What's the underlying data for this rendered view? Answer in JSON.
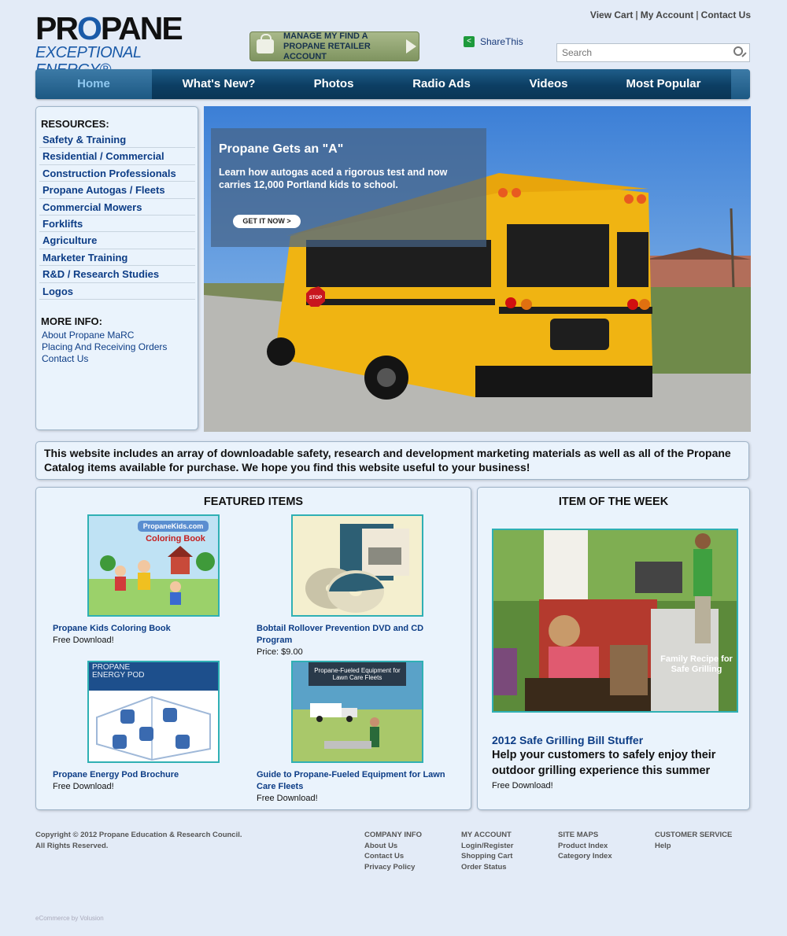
{
  "logo": {
    "word_pre": "PR",
    "word_o": "O",
    "word_post": "PANE",
    "tagline": "EXCEPTIONAL ENERGY®"
  },
  "top_links": {
    "cart": "View Cart",
    "account": "My Account",
    "contact": "Contact Us",
    "separator": "|"
  },
  "manage_button": {
    "label": "MANAGE MY FIND A PROPANE RETAILER ACCOUNT"
  },
  "share": {
    "label": "ShareThis"
  },
  "search": {
    "placeholder": "Search"
  },
  "nav": {
    "items": [
      {
        "label": "Home",
        "active": true
      },
      {
        "label": "What's New?"
      },
      {
        "label": "Photos"
      },
      {
        "label": "Radio Ads"
      },
      {
        "label": "Videos"
      },
      {
        "label": "Most Popular"
      }
    ]
  },
  "sidebar": {
    "resources_heading": "RESOURCES:",
    "resources": [
      "Safety & Training",
      "Residential / Commercial",
      "Construction Professionals",
      "Propane Autogas / Fleets",
      "Commercial Mowers",
      "Forklifts",
      "Agriculture",
      "Marketer Training",
      "R&D / Research Studies",
      "Logos"
    ],
    "more_heading": "MORE INFO:",
    "more": [
      "About Propane MaRC",
      "Placing And Receiving Orders",
      "Contact Us"
    ]
  },
  "hero": {
    "title": "Propane Gets an \"A\"",
    "text": "Learn how autogas aced a rigorous test and now carries 12,000 Portland kids to school.",
    "button": "GET IT NOW >",
    "stop_sign": "STOP"
  },
  "intro": {
    "text": "This website includes an array of downloadable safety, research and development marketing materials as well as all of the Propane Catalog items available for purchase. We hope you find this website useful to your business!"
  },
  "featured": {
    "heading": "FEATURED ITEMS",
    "items": [
      {
        "title": "Propane Kids Coloring Book",
        "sub": "Free Download!",
        "img_title": "PropaneKids.com",
        "img_sub": "Coloring Book"
      },
      {
        "title": "Bobtail Rollover Prevention DVD and CD Program",
        "sub": "Price: $9.00"
      },
      {
        "title": "Propane Energy Pod Brochure",
        "sub": "Free Download!",
        "img_title": "PROPANE ENERGY POD"
      },
      {
        "title": "Guide to Propane-Fueled Equipment for Lawn Care Fleets",
        "sub": "Free Download!",
        "img_title": "Propane-Fueled Equipment for Lawn Care Fleets"
      }
    ]
  },
  "week": {
    "heading": "ITEM OF THE WEEK",
    "img_caption": "Family Recipe for Safe Grilling",
    "title": "2012 Safe Grilling Bill Stuffer",
    "text": "Help your customers to safely enjoy their outdoor grilling experience this summer",
    "sub": "Free Download!"
  },
  "footer": {
    "copyright_1": "Copyright © 2012 Propane Education & Research Council.",
    "copyright_2": "All Rights Reserved.",
    "columns": [
      {
        "heading": "COMPANY INFO",
        "links": [
          "About Us",
          "Contact Us",
          "Privacy Policy"
        ]
      },
      {
        "heading": "MY ACCOUNT",
        "links": [
          "Login/Register",
          "Shopping Cart",
          "Order Status"
        ]
      },
      {
        "heading": "SITE MAPS",
        "links": [
          "Product Index",
          "Category Index"
        ]
      },
      {
        "heading": "CUSTOMER SERVICE",
        "links": [
          "Help"
        ]
      }
    ],
    "ecommerce": "eCommerce by Volusion"
  },
  "colors": {
    "page_bg": "#e3ebf7",
    "nav_blue": "#0c3e63",
    "link_blue": "#0d3d86",
    "accent_teal": "#2fb0b4"
  }
}
